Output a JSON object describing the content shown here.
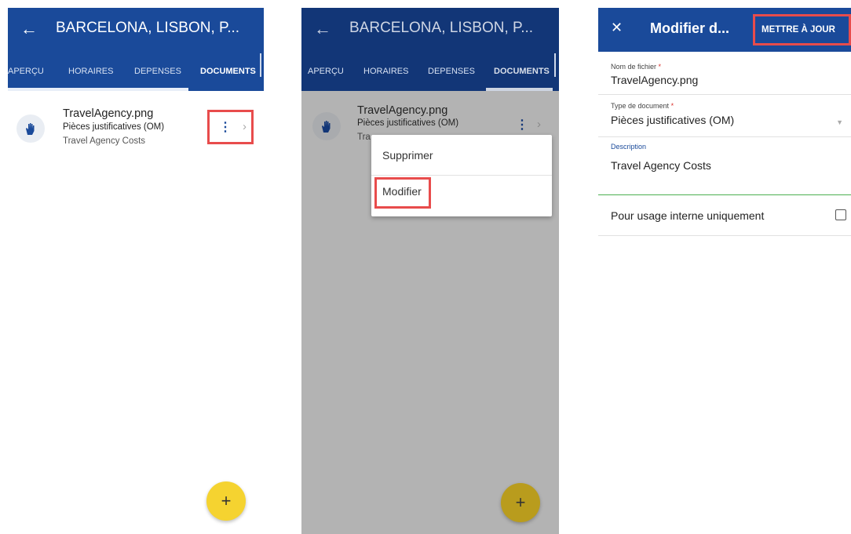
{
  "screen1": {
    "title": "BARCELONA, LISBON, P...",
    "tabs": [
      "APERÇU",
      "HORAIRES",
      "DEPENSES",
      "DOCUMENTS"
    ],
    "document": {
      "name": "TravelAgency.png",
      "type": "Pièces justificatives (OM)",
      "description": "Travel Agency Costs"
    },
    "fab_label": "+"
  },
  "screen2": {
    "title": "BARCELONA, LISBON, P...",
    "tabs": [
      "APERÇU",
      "HORAIRES",
      "DEPENSES",
      "DOCUMENTS"
    ],
    "document": {
      "name": "TravelAgency.png",
      "type": "Pièces justificatives (OM)",
      "description_visible": "Tra"
    },
    "menu": {
      "delete_label": "Supprimer",
      "edit_label": "Modifier"
    },
    "fab_label": "+"
  },
  "screen3": {
    "title": "Modifier d...",
    "update_label": "METTRE À JOUR",
    "filename_label": "Nom de fichier",
    "filename_value": "TravelAgency.png",
    "doctype_label": "Type de document",
    "doctype_value": "Pièces justificatives (OM)",
    "description_label": "Description",
    "description_value": "Travel Agency Costs",
    "internal_label": "Pour usage interne uniquement",
    "required_mark": "*"
  },
  "icons": {
    "back": "arrow-left-icon",
    "close": "close-icon",
    "document": "hand-paper-icon",
    "menu": "kebab-menu-icon",
    "chevron": "chevron-right-icon",
    "dropdown": "caret-down-icon",
    "add": "plus-icon"
  },
  "colors": {
    "primary": "#1a4a9a",
    "fab": "#f5d330",
    "highlight": "#e84c4c",
    "required": "#d9302c",
    "overlay": "#b3b3b3"
  }
}
